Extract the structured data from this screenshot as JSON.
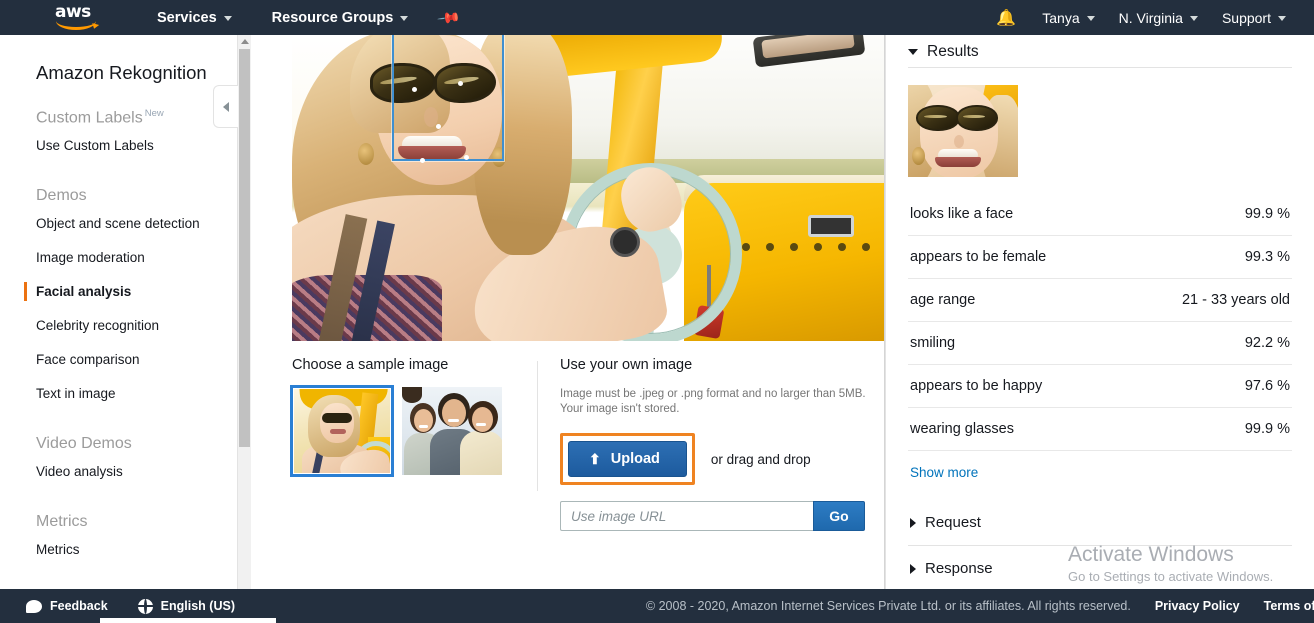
{
  "topnav": {
    "logo_text": "aws",
    "services_label": "Services",
    "resource_groups_label": "Resource Groups",
    "pin_icon": "pin-icon",
    "bell_icon": "bell-icon",
    "account_label": "Tanya",
    "region_label": "N. Virginia",
    "support_label": "Support"
  },
  "sidebar": {
    "title": "Amazon Rekognition",
    "groups": [
      {
        "label": "Custom Labels",
        "badge": "New",
        "items": [
          {
            "label": "Use Custom Labels",
            "active": false
          }
        ]
      },
      {
        "label": "Demos",
        "badge": "",
        "items": [
          {
            "label": "Object and scene detection",
            "active": false
          },
          {
            "label": "Image moderation",
            "active": false
          },
          {
            "label": "Facial analysis",
            "active": true
          },
          {
            "label": "Celebrity recognition",
            "active": false
          },
          {
            "label": "Face comparison",
            "active": false
          },
          {
            "label": "Text in image",
            "active": false
          }
        ]
      },
      {
        "label": "Video Demos",
        "badge": "",
        "items": [
          {
            "label": "Video analysis",
            "active": false
          }
        ]
      },
      {
        "label": "Metrics",
        "badge": "",
        "items": [
          {
            "label": "Metrics",
            "active": false
          }
        ]
      }
    ]
  },
  "main": {
    "sample_section_title": "Choose a sample image",
    "own_image_section_title": "Use your own image",
    "own_image_help": "Image must be .jpeg or .png format and no larger than 5MB. Your image isn't stored.",
    "upload_button_label": "Upload",
    "upload_icon": "upload-icon",
    "drag_drop_label": "or drag and drop",
    "url_placeholder": "Use image URL",
    "url_value": "",
    "go_button_label": "Go",
    "samples": [
      {
        "name": "woman-driving-yellow-car",
        "selected": true
      },
      {
        "name": "family-group-photo",
        "selected": false
      }
    ]
  },
  "results": {
    "header_label": "Results",
    "expanded": true,
    "attributes": [
      {
        "label": "looks like a face",
        "value": "99.9 %"
      },
      {
        "label": "appears to be female",
        "value": "99.3 %"
      },
      {
        "label": "age range",
        "value": "21 - 33 years old"
      },
      {
        "label": "smiling",
        "value": "92.2 %"
      },
      {
        "label": "appears to be happy",
        "value": "97.6 %"
      },
      {
        "label": "wearing glasses",
        "value": "99.9 %"
      }
    ],
    "show_more_label": "Show more",
    "request_label": "Request",
    "response_label": "Response"
  },
  "watermark": {
    "line1": "Activate Windows",
    "line2": "Go to Settings to activate Windows."
  },
  "footer": {
    "feedback_label": "Feedback",
    "language_label": "English (US)",
    "copyright": "© 2008 - 2020, Amazon Internet Services Private Ltd. or its affiliates. All rights reserved.",
    "privacy_label": "Privacy Policy",
    "terms_label": "Terms of U"
  },
  "colors": {
    "nav_bg": "#232f3e",
    "accent_orange": "#ec7211",
    "link_blue": "#0073bb",
    "button_blue": "#1d5b9e",
    "highlight_ring": "#ef8321",
    "selection_blue": "#2a7fd4"
  }
}
